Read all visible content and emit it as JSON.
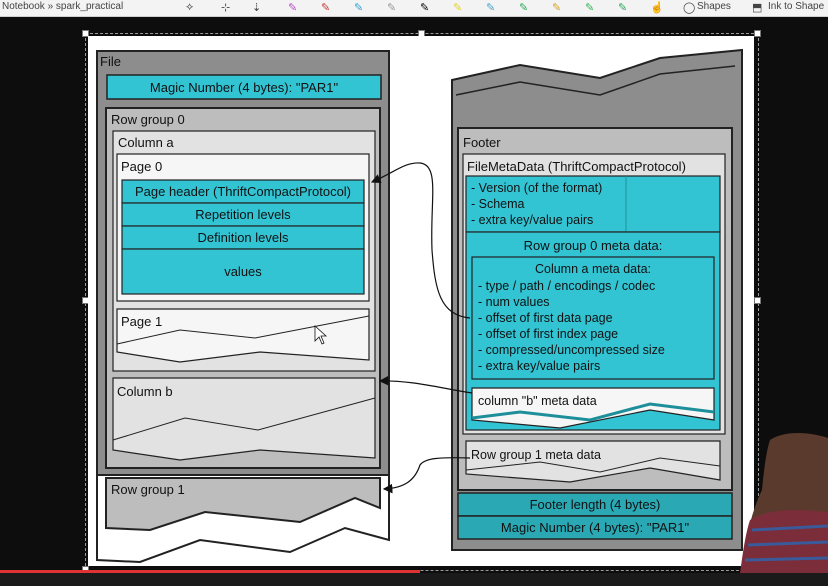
{
  "toolbar": {
    "breadcrumb": "Notebook » spark_practical",
    "shapes_label": "Shapes",
    "ink_label": "Ink to Shape",
    "pen_colors": [
      "#b84fc7",
      "#c43a3a",
      "#2fa3d6",
      "#9a9a9a",
      "#000000",
      "#e6d12a",
      "#4aa3c8",
      "#2eaa5a",
      "#d6a22a",
      "#35b35e",
      "#2eaa5a"
    ]
  },
  "diagram": {
    "file": {
      "title": "File",
      "magic": "Magic Number (4 bytes): \"PAR1\"",
      "rowgroup0": "Row group 0",
      "column_a": "Column a",
      "page0": "Page 0",
      "page_header": "Page header (ThriftCompactProtocol)",
      "repetition": "Repetition levels",
      "definition": "Definition levels",
      "values": "values",
      "page1": "Page 1",
      "column_b": "Column b",
      "rowgroup1": "Row group 1"
    },
    "footer": {
      "title": "Footer",
      "filemeta": "FileMetaData (ThriftCompactProtocol)",
      "items": [
        "- Version (of the format)",
        "- Schema",
        "- extra key/value pairs"
      ],
      "rg0_meta": "Row group 0 meta data:",
      "col_a_meta_title": "Column a meta data:",
      "col_a_items": [
        "- type / path / encodings / codec",
        "- num values",
        "- offset of first data page",
        "- offset of first index page",
        "- compressed/uncompressed size",
        "- extra key/value pairs"
      ],
      "col_b_meta": "column \"b\" meta data",
      "rg1_meta": "Row group 1 meta data",
      "footer_length": "Footer length (4 bytes)",
      "magic": "Magic Number (4 bytes): \"PAR1\""
    },
    "colors": {
      "cyan": "#33c4d4",
      "teal": "#2aa9b5",
      "gray": "#a9a9a9",
      "light": "#e2e2e2",
      "white": "#f6f6f6"
    }
  }
}
